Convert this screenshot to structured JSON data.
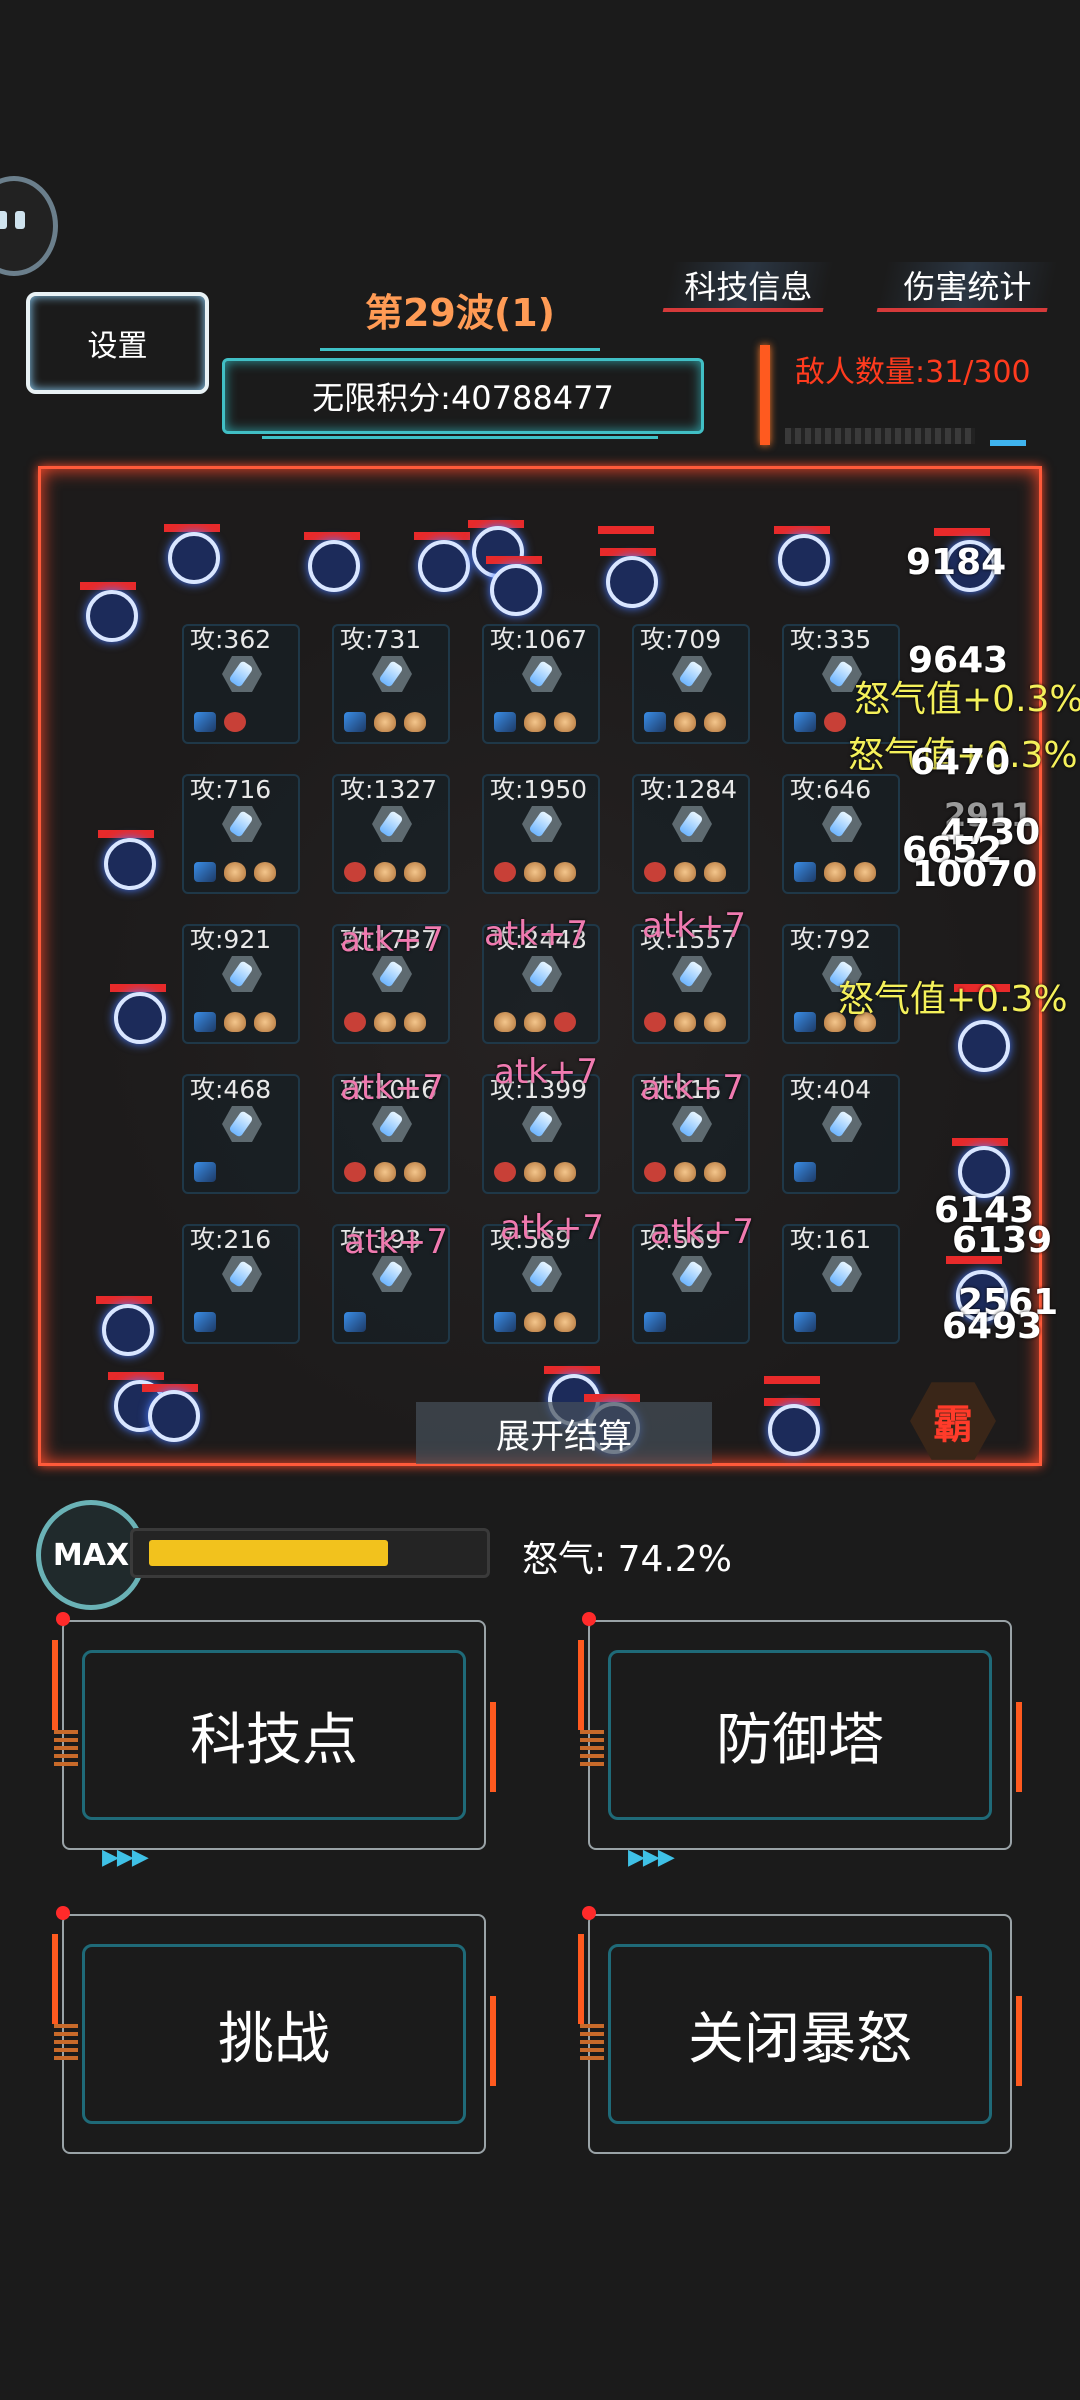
{
  "header": {
    "settings_label": "设置",
    "wave_title": "第29波(1)",
    "score_text": "无限积分:40788477",
    "tech_info_label": "科技信息",
    "damage_stats_label": "伤害统计",
    "enemy_count_text": "敌人数量:31/300"
  },
  "towers": [
    {
      "atk": "攻:362",
      "icons": [
        "blue",
        "red"
      ]
    },
    {
      "atk": "攻:731",
      "icons": [
        "blue",
        "beast",
        "beast"
      ]
    },
    {
      "atk": "攻:1067",
      "icons": [
        "blue",
        "beast",
        "beast"
      ]
    },
    {
      "atk": "攻:709",
      "icons": [
        "blue",
        "beast",
        "beast"
      ]
    },
    {
      "atk": "攻:335",
      "icons": [
        "blue",
        "red"
      ]
    },
    {
      "atk": "攻:716",
      "icons": [
        "blue",
        "beast",
        "beast"
      ]
    },
    {
      "atk": "攻:1327",
      "icons": [
        "red",
        "beast",
        "beast"
      ]
    },
    {
      "atk": "攻:1950",
      "icons": [
        "red",
        "beast",
        "beast"
      ]
    },
    {
      "atk": "攻:1284",
      "icons": [
        "red",
        "beast",
        "beast"
      ]
    },
    {
      "atk": "攻:646",
      "icons": [
        "blue",
        "beast",
        "beast"
      ]
    },
    {
      "atk": "攻:921",
      "icons": [
        "blue",
        "beast",
        "beast"
      ]
    },
    {
      "atk": "攻:1737",
      "icons": [
        "red",
        "beast",
        "beast"
      ]
    },
    {
      "atk": "攻:2443",
      "icons": [
        "beast",
        "beast",
        "red"
      ]
    },
    {
      "atk": "攻:1557",
      "icons": [
        "red",
        "beast",
        "beast"
      ]
    },
    {
      "atk": "攻:792",
      "icons": [
        "blue",
        "beast",
        "beast"
      ]
    },
    {
      "atk": "攻:468",
      "icons": [
        "blue"
      ]
    },
    {
      "atk": "攻:1016",
      "icons": [
        "red",
        "beast",
        "beast"
      ]
    },
    {
      "atk": "攻:1399",
      "icons": [
        "red",
        "beast",
        "beast"
      ]
    },
    {
      "atk": "攻:916",
      "icons": [
        "red",
        "beast",
        "beast"
      ]
    },
    {
      "atk": "攻:404",
      "icons": [
        "blue"
      ]
    },
    {
      "atk": "攻:216",
      "icons": [
        "blue"
      ]
    },
    {
      "atk": "攻:393",
      "icons": [
        "blue"
      ]
    },
    {
      "atk": "攻:589",
      "icons": [
        "blue",
        "beast",
        "beast"
      ]
    },
    {
      "atk": "攻:569",
      "icons": [
        "blue"
      ]
    },
    {
      "atk": "攻:161",
      "icons": [
        "blue"
      ]
    }
  ],
  "floating_texts": {
    "dmg_1": "9184",
    "dmg_2": "9643",
    "dmg_3": "6470",
    "dmg_4": "6652",
    "dmg_5": "10070",
    "dmg_6": "4730",
    "dmg_7": "2911",
    "dmg_8": "6143",
    "dmg_9": "2561",
    "dmg_10": "6493",
    "dmg_11": "6139",
    "rage_gain_1": "怒气值+0.3%",
    "rage_gain_2": "怒气值+0.3%",
    "rage_gain_3": "怒气值+0.3%",
    "atk_buff": "atk+7"
  },
  "battle": {
    "expand_label": "展开结算",
    "ba_label": "霸"
  },
  "rage": {
    "max_label": "MAX",
    "label": "怒气: 74.2%",
    "fill_fraction": 0.742
  },
  "actions": {
    "tech_points": "科技点",
    "defense_tower": "防御塔",
    "challenge": "挑战",
    "close_rage": "关闭暴怒"
  },
  "colors": {
    "accent_orange": "#ff5a1f",
    "cyan": "#41bfc5",
    "rage_yellow": "#f2c21d",
    "enemy_red": "#ff3b1e"
  }
}
